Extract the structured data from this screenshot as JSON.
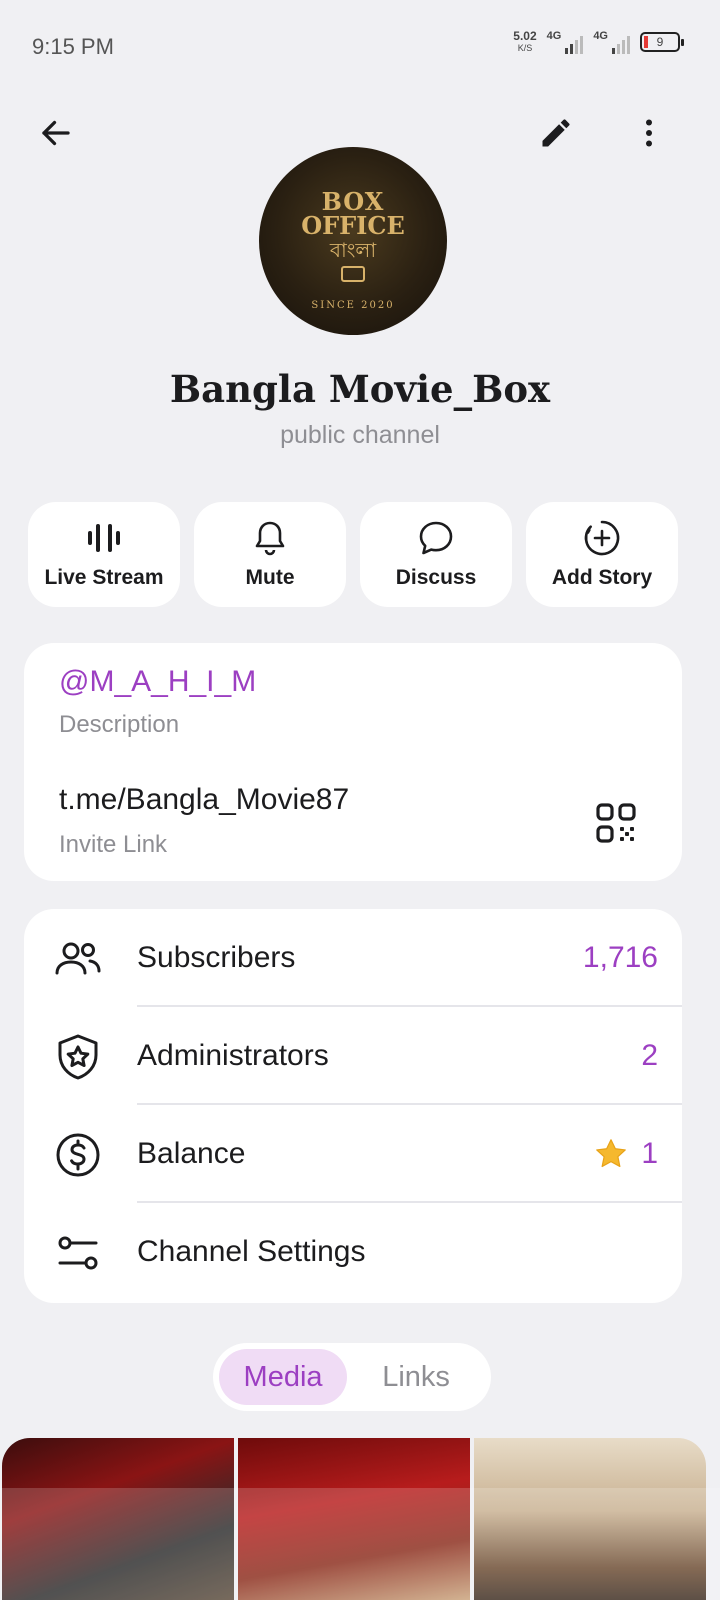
{
  "status_bar": {
    "time": "9:15 PM",
    "speed_value": "5.02",
    "speed_unit": "K/S",
    "net1": "4G",
    "net2": "4G",
    "battery": "9"
  },
  "channel": {
    "name": "Bangla Movie_Box",
    "subtitle": "public channel",
    "avatar_lines": [
      "BOX",
      "OFFICE",
      "বাংলা",
      "SINCE 2020"
    ]
  },
  "actions": [
    {
      "label": "Live Stream",
      "icon": "live-stream-icon"
    },
    {
      "label": "Mute",
      "icon": "bell-icon"
    },
    {
      "label": "Discuss",
      "icon": "chat-bubble-icon"
    },
    {
      "label": "Add Story",
      "icon": "add-story-icon"
    }
  ],
  "info": {
    "username": "@M_A_H_I_M",
    "username_label": "Description",
    "invite_link": "t.me/Bangla_Movie87",
    "invite_label": "Invite Link"
  },
  "list": [
    {
      "label": "Subscribers",
      "value": "1,716",
      "icon": "people-icon"
    },
    {
      "label": "Administrators",
      "value": "2",
      "icon": "shield-star-icon"
    },
    {
      "label": "Balance",
      "value": "1",
      "icon": "dollar-circle-icon",
      "badge": "star-icon"
    },
    {
      "label": "Channel Settings",
      "value": "",
      "icon": "sliders-icon"
    }
  ],
  "tabs": {
    "media": "Media",
    "links": "Links"
  },
  "colors": {
    "accent": "#9c3fc2",
    "accent_bg": "#f0dcf5",
    "background": "#f0f0f3",
    "card": "#ffffff"
  }
}
